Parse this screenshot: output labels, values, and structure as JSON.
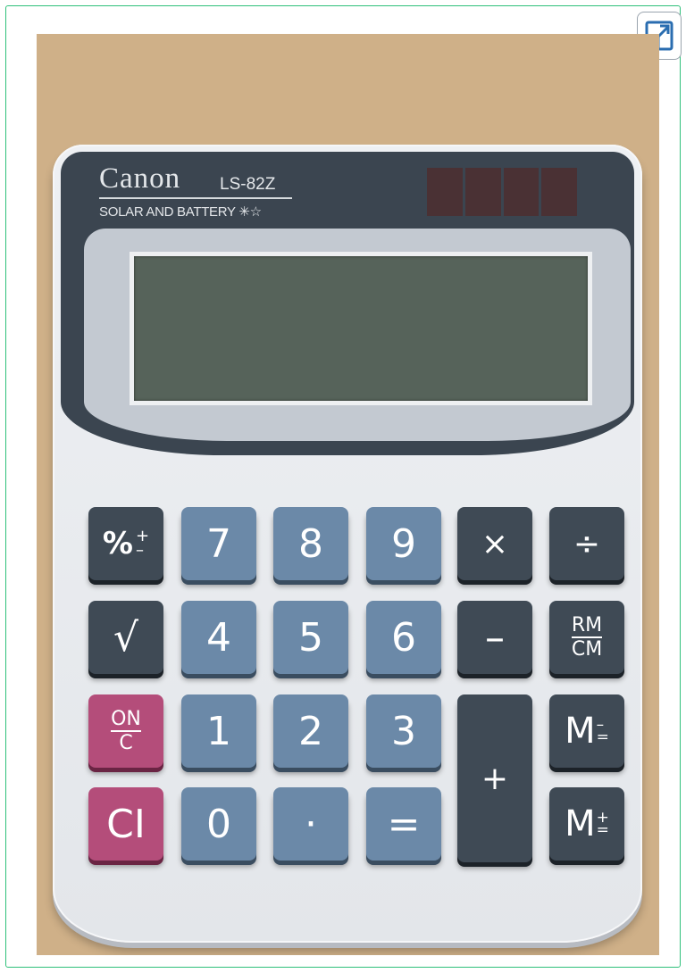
{
  "calculator": {
    "brand": "Canon",
    "model": "LS-82Z",
    "power_label": "SOLAR AND BATTERY ✳☆",
    "display_value": ""
  },
  "keys": {
    "percent": "%",
    "percent_plus": "+",
    "percent_minus": "–",
    "sqrt": "√",
    "on_top": "ON",
    "on_bottom": "C",
    "clear": "CI",
    "seven": "7",
    "eight": "8",
    "nine": "9",
    "four": "4",
    "five": "5",
    "six": "6",
    "one": "1",
    "two": "2",
    "three": "3",
    "zero": "0",
    "dot": "·",
    "equals": "=",
    "multiply": "×",
    "divide": "÷",
    "minus": "–",
    "plus": "+",
    "rm_top": "RM",
    "rm_bottom": "CM",
    "m_minus_letter": "M",
    "m_minus_top": "–",
    "m_minus_bottom": "=",
    "m_plus_letter": "M",
    "m_plus_top": "+",
    "m_plus_bottom": "="
  },
  "colors": {
    "frame_border": "#2fc07a",
    "background": "#cfb088",
    "panel": "#3b4550",
    "lcd": "#56635a",
    "key_dark": "#3f4a55",
    "key_blue": "#6b89a8",
    "key_pink": "#b44d7a"
  },
  "icons": {
    "expand": "expand-icon"
  }
}
